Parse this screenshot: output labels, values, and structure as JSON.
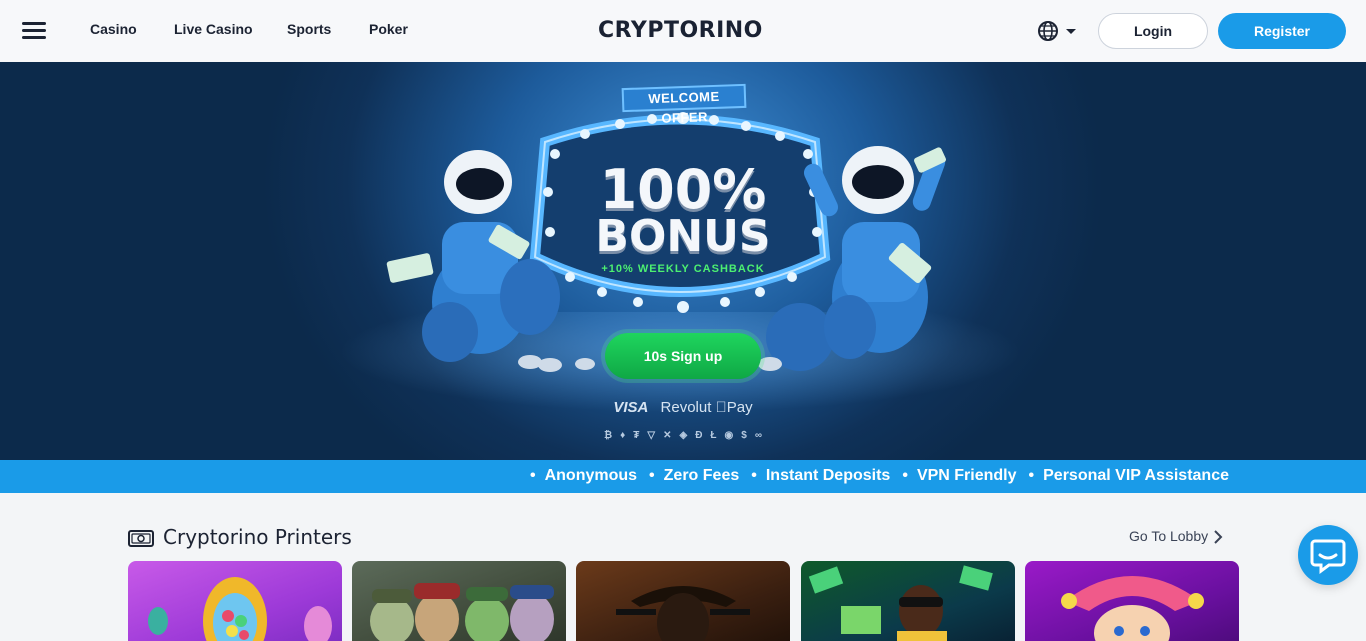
{
  "header": {
    "nav": [
      "Casino",
      "Live Casino",
      "Sports",
      "Poker"
    ],
    "logo": "CRYPTORINO",
    "login_label": "Login",
    "register_label": "Register"
  },
  "hero": {
    "ribbon": "WELCOME OFFER",
    "bonus_percent": "100%",
    "bonus_word": "BONUS",
    "bonus_sub": "+10% WEEKLY CASHBACK",
    "signup_label": "10s Sign up",
    "payments": [
      "VISA",
      "Revolut",
      "Pay"
    ],
    "crypto_icons": [
      "bitcoin-icon",
      "ethereum-icon",
      "tether-icon",
      "tron-icon",
      "ripple-icon",
      "bnb-icon",
      "dogecoin-icon",
      "litecoin-icon",
      "shiba-icon",
      "usdc-icon",
      "chainlink-icon"
    ]
  },
  "features": [
    "Anonymous",
    "Zero Fees",
    "Instant Deposits",
    "VPN Friendly",
    "Personal VIP Assistance"
  ],
  "section": {
    "title": "Cryptorino Printers",
    "lobby_label": "Go To Lobby"
  },
  "colors": {
    "accent": "#1a9be8",
    "signup_green": "#12c053",
    "hero_dark": "#0f3158"
  }
}
